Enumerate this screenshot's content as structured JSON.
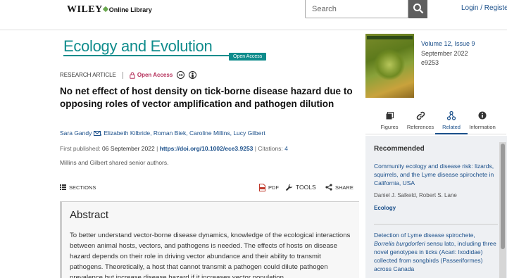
{
  "header": {
    "brand": "WILEY",
    "brand_sub": "Online Library",
    "search_placeholder": "Search",
    "login": "Login / Register"
  },
  "journal": {
    "title": "Ecology and Evolution",
    "badge": "Open Access"
  },
  "article": {
    "type": "RESEARCH ARTICLE",
    "access": "Open Access",
    "title": "No net effect of host density on tick-borne disease hazard due to opposing roles of vector amplification and pathogen dilution",
    "authors": [
      "Sara Gandy",
      "Elizabeth Kilbride",
      "Roman Biek",
      "Caroline Millins",
      "Lucy Gilbert"
    ],
    "published_label": "First published:",
    "published_date": "06 September 2022",
    "doi": "https://doi.org/10.1002/ece3.9253",
    "citations_label": "Citations:",
    "citations": "4",
    "note": "Millins and Gilbert shared senior authors."
  },
  "toolbar": {
    "sections": "SECTIONS",
    "pdf": "PDF",
    "tools": "TOOLS",
    "share": "SHARE"
  },
  "abstract": {
    "heading": "Abstract",
    "text": "To better understand vector-borne disease dynamics, knowledge of the ecological interactions between animal hosts, vectors, and pathogens is needed. The effects of hosts on disease hazard depends on their role in driving vector abundance and their ability to transmit pathogens. Theoretically, a host that cannot transmit a pathogen could dilute pathogen prevalence but increase disease hazard if it increases vector population"
  },
  "issue": {
    "volume": "Volume 12, Issue 9",
    "date": "September 2022",
    "eid": "e9253"
  },
  "right_tabs": [
    {
      "label": "Figures",
      "icon": "figures-icon"
    },
    {
      "label": "References",
      "icon": "link-icon"
    },
    {
      "label": "Related",
      "icon": "related-icon"
    },
    {
      "label": "Information",
      "icon": "info-icon"
    }
  ],
  "recommended": {
    "heading": "Recommended",
    "items": [
      {
        "title": "Community ecology and disease risk: lizards, squirrels, and the Lyme disease spirochete in California, USA",
        "authors": "Daniel J. Salkeld, Robert S. Lane",
        "journal": "Ecology"
      },
      {
        "title_pre": "Detection of Lyme disease spirochete, ",
        "title_em": "Borrelia burgdorferi",
        "title_post": " sensu lato, including three novel genotypes in ticks (Acari: Ixodidae) collected from songbirds (Passeriformes) across Canada"
      }
    ]
  }
}
